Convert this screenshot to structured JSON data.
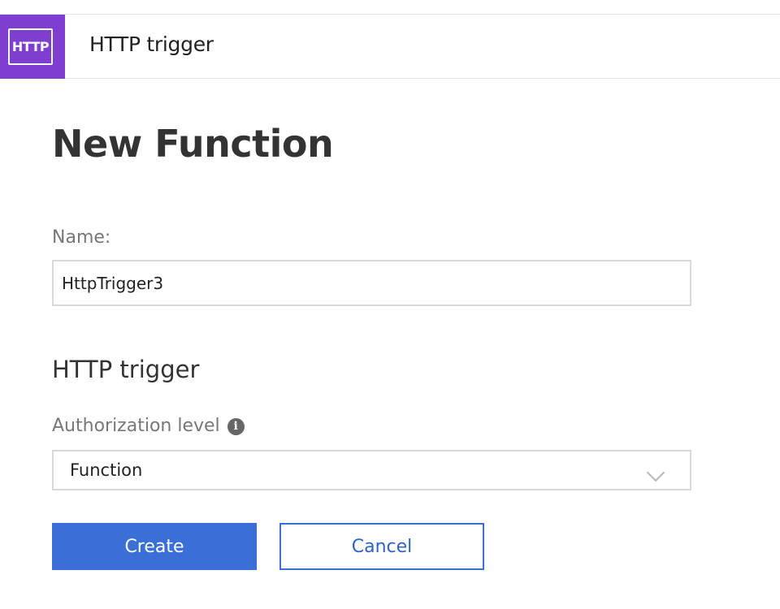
{
  "header": {
    "icon_label": "HTTP",
    "icon_color": "#7e3fd0",
    "title": "HTTP trigger"
  },
  "page": {
    "title": "New Function"
  },
  "form": {
    "name_label": "Name:",
    "name_value": "HttpTrigger3",
    "section_title": "HTTP trigger",
    "auth_label": "Authorization level",
    "auth_info_icon": "info-icon",
    "auth_value": "Function"
  },
  "actions": {
    "create_label": "Create",
    "cancel_label": "Cancel",
    "accent_color": "#3a6fd8"
  }
}
